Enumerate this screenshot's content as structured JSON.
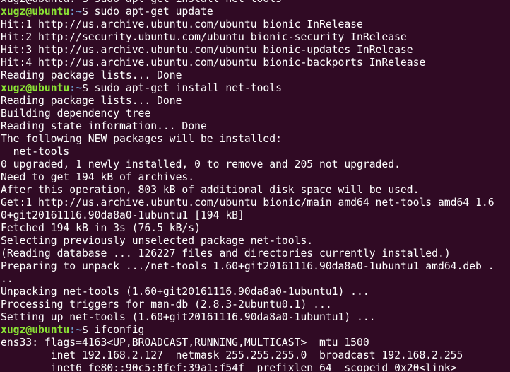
{
  "theme": {
    "background": "#300a24",
    "foreground": "#ffffff",
    "prompt_user_color": "#8ae234",
    "prompt_path_color": "#729fcf"
  },
  "terminal": {
    "lines": [
      {
        "type": "partial",
        "text": "xugz@ubuntu:~$ sudo apt-get install net-tools"
      },
      {
        "type": "prompt",
        "user": "xugz@ubuntu",
        "path": ":~",
        "sign": "$ ",
        "command": "sudo apt-get update"
      },
      {
        "type": "output",
        "text": "Hit:1 http://us.archive.ubuntu.com/ubuntu bionic InRelease"
      },
      {
        "type": "output",
        "text": "Hit:2 http://security.ubuntu.com/ubuntu bionic-security InRelease"
      },
      {
        "type": "output",
        "text": "Hit:3 http://us.archive.ubuntu.com/ubuntu bionic-updates InRelease"
      },
      {
        "type": "output",
        "text": "Hit:4 http://us.archive.ubuntu.com/ubuntu bionic-backports InRelease"
      },
      {
        "type": "output",
        "text": "Reading package lists... Done"
      },
      {
        "type": "prompt",
        "user": "xugz@ubuntu",
        "path": ":~",
        "sign": "$ ",
        "command": "sudo apt-get install net-tools"
      },
      {
        "type": "output",
        "text": "Reading package lists... Done"
      },
      {
        "type": "output",
        "text": "Building dependency tree"
      },
      {
        "type": "output",
        "text": "Reading state information... Done"
      },
      {
        "type": "output",
        "text": "The following NEW packages will be installed:"
      },
      {
        "type": "output",
        "text": "  net-tools"
      },
      {
        "type": "output",
        "text": "0 upgraded, 1 newly installed, 0 to remove and 205 not upgraded."
      },
      {
        "type": "output",
        "text": "Need to get 194 kB of archives."
      },
      {
        "type": "output",
        "text": "After this operation, 803 kB of additional disk space will be used."
      },
      {
        "type": "output",
        "text": "Get:1 http://us.archive.ubuntu.com/ubuntu bionic/main amd64 net-tools amd64 1.6"
      },
      {
        "type": "output",
        "text": "0+git20161116.90da8a0-1ubuntu1 [194 kB]"
      },
      {
        "type": "output",
        "text": "Fetched 194 kB in 3s (76.5 kB/s)"
      },
      {
        "type": "output",
        "text": "Selecting previously unselected package net-tools."
      },
      {
        "type": "output",
        "text": "(Reading database ... 126227 files and directories currently installed.)"
      },
      {
        "type": "output",
        "text": "Preparing to unpack .../net-tools_1.60+git20161116.90da8a0-1ubuntu1_amd64.deb ."
      },
      {
        "type": "output",
        "text": ".."
      },
      {
        "type": "output",
        "text": "Unpacking net-tools (1.60+git20161116.90da8a0-1ubuntu1) ..."
      },
      {
        "type": "output",
        "text": "Processing triggers for man-db (2.8.3-2ubuntu0.1) ..."
      },
      {
        "type": "output",
        "text": "Setting up net-tools (1.60+git20161116.90da8a0-1ubuntu1) ..."
      },
      {
        "type": "prompt",
        "user": "xugz@ubuntu",
        "path": ":~",
        "sign": "$ ",
        "command": "ifconfig"
      },
      {
        "type": "output",
        "text": "ens33: flags=4163<UP,BROADCAST,RUNNING,MULTICAST>  mtu 1500"
      },
      {
        "type": "output",
        "text": "        inet 192.168.2.127  netmask 255.255.255.0  broadcast 192.168.2.255"
      },
      {
        "type": "output",
        "text": "        inet6 fe80::90c5:8fef:39a1:f54f  prefixlen 64  scopeid 0x20<link>"
      }
    ]
  }
}
